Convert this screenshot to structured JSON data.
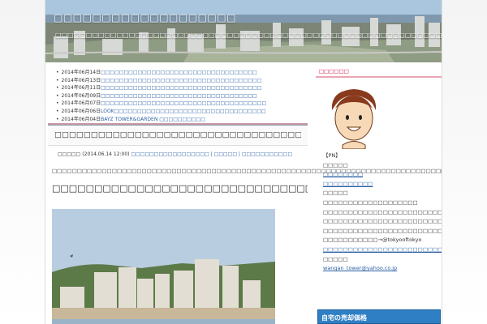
{
  "header": {
    "title": "□□□□□□□□□□□□□□□□□□□",
    "description": "□□□□□□□□□□□□□□□□□□□□□□□□□□□□□□□□□□□□□□□□□□□□□□□□□□□□□□□□□□□□□□□□□□□□□□□□□□□□□□□□□□□□"
  },
  "recent": [
    {
      "date": "2014年06月14日",
      "title": "□□□□□□□□□□□□□□□□□□□□□□□□□□□□□□□□□□"
    },
    {
      "date": "2014年06月13日",
      "title": "□□□□□□□□□□□□□□□□□□□□□□□□□□□□□□□□□□□"
    },
    {
      "date": "2014年06月11日",
      "title": "□□□□□□□□□□□□□□□□□□□□□□□□□□□□□□□□□□□"
    },
    {
      "date": "2014年06月09日",
      "title": "□□□□□□□□□□□□□□□□□□□□□□□□□□□□□□□□□□"
    },
    {
      "date": "2014年06月07日",
      "title": "□□□□□□□□□□□□□□□□□□□□□□□□□□□□□□□□□□□□"
    },
    {
      "date": "2014年06月06日",
      "title": "LOOK□□□□□□□□□□□□□□□□□□□□□□□□□□□□□□□□□"
    },
    {
      "date": "2014年06月04日",
      "title": "BAYZ TOWER&GARDEN □□□□□□□□□□"
    }
  ],
  "post": {
    "title": "□□□□□□□□□□□□□□□□□□□□□□□□□□□□□□□□□□",
    "author": "□□□□□",
    "datetime": "(2014.06.14 12:00)",
    "meta_links": "□□□□□□□□□□□□□□□□□ | □□□□□ | □□□□□□□□□□□",
    "body": "□□□□□□□□□□□□□□□□□□□□□□□□□□□□□□□□□□□□□□□□□□□□□□□□□□□□□□□□□□□□□□□□□□□□□□□□□□□□□□□□□□□□□□□",
    "heading": "□□□□□□□□□□□□□□□□□□□□□□□□□□□□□□□□□□□□□□□□□□"
  },
  "sidebar": {
    "profile_heading": "□□□□□□",
    "profile_lines": [
      "【PN】",
      "□□□□□",
      "□□□□□□□□",
      "□□□□□□□□□□",
      "□□□□□",
      "□□□□□□□□□□□□□□□□□□□",
      "□□□□□□□□□□□□□□□□□□□□□□□□□□□□□□□□□□□□□□",
      "□□□□□□□□□□□□□□□□□□□□□□□□□□□□□□□□□□□□□□□□",
      "□□□□□□□□□□□□□□□□□□□□□□□□□□□□□□□□□□□□□□□□□",
      "□□□□□□□□□□□→@tokyooftokyo",
      "□□□□□□□□□□□□□□□□□□□□□□□□□□□□□□□□□□□□□□□□□□",
      "□□□□□",
      "wangan_tower@yahoo.co.jp"
    ],
    "ad_text": "自宅の売却価格"
  }
}
